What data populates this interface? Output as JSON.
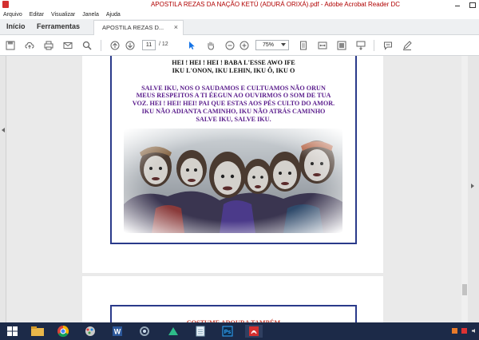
{
  "window": {
    "title": "APOSTILA REZAS DA NAÇÃO KETÚ (ADURÁ ORIXÁ).pdf - Adobe Acrobat Reader DC"
  },
  "menu": [
    "Arquivo",
    "Editar",
    "Visualizar",
    "Janela",
    "Ajuda"
  ],
  "tabs": {
    "home": "Início",
    "tools": "Ferramentas",
    "document": "APOSTILA REZAS D..."
  },
  "toolbar": {
    "current_page": "11",
    "total_pages": "/ 12",
    "zoom": "75%"
  },
  "document": {
    "lines_black": [
      "HEI ! HEI ! HEI ! BABA L'ESSE AWO IFE",
      "IKU L'ONON, IKU LEHIN, IKU Ô, IKU O"
    ],
    "lines_purple": [
      "SALVE IKU, NOS O SAUDAMOS E CULTUAMOS NÃO ORUN",
      "MEUS RESPEITOS A TI ÉEGUN AO OUVIRMOS O SOM DE TUA",
      "VOZ. HEI ! HEI! HEI! PAI QUE ESTAS AOS PÉS CULTO DO AMOR.",
      "IKU NÃO ADIANTA CAMINHO, IKU NÃO ATRÁS CAMINHO",
      "SALVE IKU, SALVE IKU."
    ],
    "next_heading": "COSTUME ADOURA TAMBÉM"
  },
  "colors": {
    "accent_red": "#c0392b",
    "text_purple": "#5a1d8c",
    "frame_blue": "#2a3a8a",
    "taskbar": "#1c2a48"
  }
}
